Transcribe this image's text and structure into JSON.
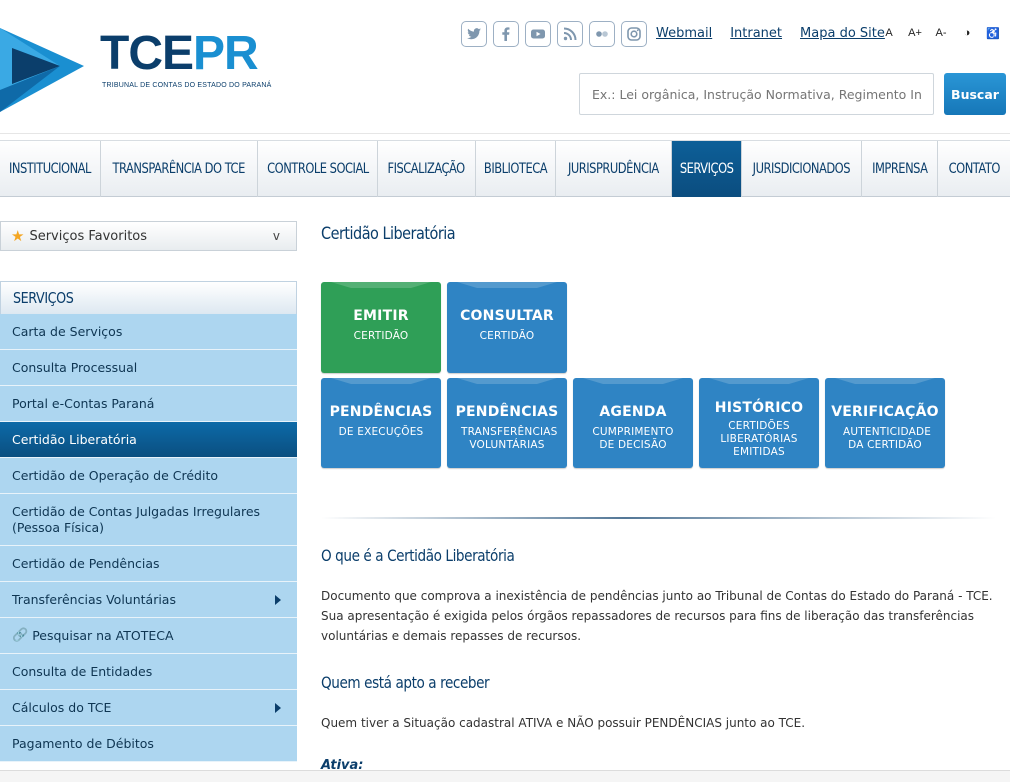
{
  "header": {
    "logo_tce": "TCE",
    "logo_pr": "PR",
    "logo_sub": "TRIBUNAL DE CONTAS DO ESTADO DO PARANÁ",
    "social_icons": [
      "twitter-icon",
      "facebook-icon",
      "youtube-icon",
      "rss-icon",
      "flickr-icon",
      "instagram-icon"
    ],
    "links": {
      "webmail": "Webmail",
      "intranet": "Intranet",
      "mapa": "Mapa do Site"
    },
    "access": {
      "a": "A",
      "a_plus": "A+",
      "a_minus": "A-",
      "contrast": "◑",
      "accessibility": "♿"
    },
    "search": {
      "placeholder": "Ex.: Lei orgânica, Instrução Normativa, Regimento Interno",
      "button": "Buscar"
    }
  },
  "nav": [
    {
      "label": "INSTITUCIONAL"
    },
    {
      "label": "TRANSPARÊNCIA DO TCE"
    },
    {
      "label": "CONTROLE SOCIAL"
    },
    {
      "label": "FISCALIZAÇÃO"
    },
    {
      "label": "BIBLIOTECA"
    },
    {
      "label": "JURISPRUDÊNCIA"
    },
    {
      "label": "SERVIÇOS"
    },
    {
      "label": "JURISDICIONADOS"
    },
    {
      "label": "IMPRENSA"
    },
    {
      "label": "CONTATO"
    }
  ],
  "sidebar": {
    "favorites": "Serviços Favoritos",
    "favorites_chevron": "v",
    "heading": "SERVIÇOS",
    "items": [
      {
        "label": "Carta de Serviços"
      },
      {
        "label": "Consulta Processual"
      },
      {
        "label": "Portal e-Contas Paraná"
      },
      {
        "label": "Certidão Liberatória"
      },
      {
        "label": "Certidão de Operação de Crédito"
      },
      {
        "label": "Certidão de Contas Julgadas Irregulares (Pessoa Física)"
      },
      {
        "label": "Certidão de Pendências"
      },
      {
        "label": "Transferências Voluntárias"
      },
      {
        "label": "Pesquisar na ATOTECA"
      },
      {
        "label": "Consulta de Entidades"
      },
      {
        "label": "Cálculos do TCE"
      },
      {
        "label": "Pagamento de Débitos"
      }
    ]
  },
  "main": {
    "title": "Certidão Liberatória",
    "tiles": [
      {
        "title": "EMITIR",
        "sub": "CERTIDÃO"
      },
      {
        "title": "CONSULTAR",
        "sub": "CERTIDÃO"
      },
      {
        "title": "PENDÊNCIAS",
        "sub": "DE EXECUÇÕES"
      },
      {
        "title": "PENDÊNCIAS",
        "sub": "TRANSFERÊNCIAS VOLUNTÁRIAS"
      },
      {
        "title": "AGENDA",
        "sub": "CUMPRIMENTO DE DECISÃO"
      },
      {
        "title": "HISTÓRICO",
        "sub": "CERTIDÕES LIBERATÓRIAS EMITIDAS"
      },
      {
        "title": "VERIFICAÇÃO",
        "sub": "AUTENTICIDADE DA CERTIDÃO"
      }
    ],
    "section1_title": "O que é a Certidão Liberatória",
    "section1_text": "Documento que comprova a inexistência de pendências junto ao Tribunal de Contas do Estado do Paraná - TCE. Sua apresentação é exigida pelos órgãos repassadores de recursos para fins de liberação das transferências voluntárias e demais repasses de recursos.",
    "section2_title": "Quem está apto a receber",
    "section2_text": "Quem tiver a Situação cadastral ATIVA e NÃO possuir PENDÊNCIAS junto ao TCE.",
    "ativa_label": "Ativa:"
  },
  "colors": {
    "brand_dark": "#0b3e6b",
    "brand_light": "#1a8fd1",
    "tile_blue": "#2f84c4",
    "tile_green": "#2f9f57",
    "sidebar_bg": "#add6f0"
  }
}
